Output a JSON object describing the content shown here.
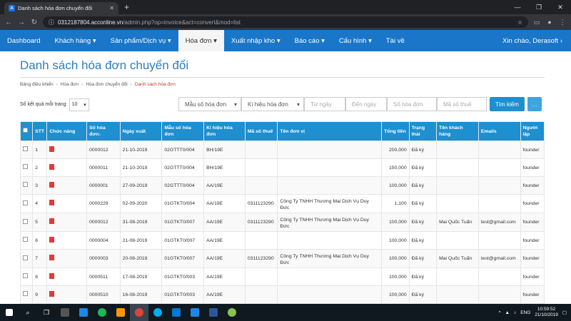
{
  "browser": {
    "tab_title": "Danh sách hóa đơn chuyển đổi",
    "tab_favicon": "A",
    "url_host": "0312187804.acconline.vn",
    "url_path": "/admin.php?op=invoice&act=convert&mod=list"
  },
  "menu": {
    "items": [
      "Dashboard",
      "Khách hàng ▾",
      "Sản phẩm/Dịch vụ ▾",
      "Hóa đơn ▾",
      "Xuất nhập kho ▾",
      "Báo cáo ▾",
      "Cấu hình ▾",
      "Tài về"
    ],
    "active_index": 3,
    "user": "Xin chào, Derasoft ›"
  },
  "page": {
    "title": "Danh sách hóa đơn chuyển đổi",
    "breadcrumb": [
      "Bảng điều khiển",
      "Hóa đơn",
      "Hóa đơn chuyển đổi",
      "Danh sách hóa đơn"
    ]
  },
  "filter": {
    "per_page_label": "Số kết quả mỗi trang",
    "per_page_value": "10",
    "template_select": "Mẫu số hóa đơn",
    "symbol_select": "Kí hiệu hóa đơn",
    "from_date": "Từ ngày",
    "to_date": "Đến ngày",
    "invoice_no": "Số hóa đơn",
    "tax_code": "Mã số thuế",
    "search_button": "Tìm kiếm"
  },
  "table": {
    "headers": [
      "",
      "STT",
      "Chức năng",
      "Số hóa đơn↓",
      "Ngày xuất",
      "Mẫu số hóa đơn",
      "Kí hiệu hóa đơn",
      "Mã số thuế",
      "Tên đơn vị",
      "Tổng tiền",
      "Trạng thái",
      "Tên khách hàng",
      "Emails",
      "Người lập"
    ],
    "rows": [
      [
        "1",
        "0000012",
        "21-10-2019",
        "02GTTT0/004",
        "BH/19E",
        "",
        "",
        "200,000",
        "Đã ký",
        "",
        "",
        "founder"
      ],
      [
        "2",
        "0000011",
        "21-10-2019",
        "02GTTT0/004",
        "BH/19E",
        "",
        "",
        "150,000",
        "Đã ký",
        "",
        "",
        "founder"
      ],
      [
        "3",
        "0000001",
        "27-09-2019",
        "02GTTT0/004",
        "AA/19E",
        "",
        "",
        "100,000",
        "Đã ký",
        "",
        "",
        "founder"
      ],
      [
        "4",
        "0000229",
        "02-09-2020",
        "01GTKT0/004",
        "AA/19E",
        "0311123290",
        "Công Ty TNHH Thương Mại Dịch Vụ Duy Đức",
        "1,100",
        "Đã ký",
        "",
        "",
        "founder"
      ],
      [
        "5",
        "0000012",
        "31-08-2019",
        "01GTKT0/007",
        "AA/19E",
        "0311123290",
        "Công Ty TNHH Thương Mại Dịch Vụ Duy Đức",
        "100,000",
        "Đã ký",
        "Mai Quốc Tuấn",
        "test@gmail.com",
        "founder"
      ],
      [
        "6",
        "0000004",
        "21-08-2019",
        "01GTKT0/007",
        "AA/19E",
        "",
        "",
        "100,000",
        "Đã ký",
        "",
        "",
        "founder"
      ],
      [
        "7",
        "0000003",
        "20-08-2019",
        "01GTKT0/007",
        "AA/19E",
        "0311123290",
        "Công Ty TNHH Thương Mại Dịch Vụ Duy Đức",
        "100,000",
        "Đã ký",
        "Mai Quốc Tuấn",
        "test@gmail.com",
        "founder"
      ],
      [
        "8",
        "0000511",
        "17-08-2019",
        "01GTKT0/003",
        "AA/19E",
        "",
        "",
        "100,000",
        "Đã ký",
        "",
        "",
        "founder"
      ],
      [
        "9",
        "0000510",
        "16-08-2019",
        "01GTKT0/003",
        "AA/19E",
        "",
        "",
        "100,000",
        "Đã ký",
        "",
        "",
        "founder"
      ]
    ]
  },
  "taskbar": {
    "time": "10:59:52",
    "date": "21/10/2019",
    "lang": "ENG"
  },
  "colors": {
    "menu_bg": "#1976c9",
    "title": "#2a7fc1",
    "table_header": "#1e8fcf"
  }
}
